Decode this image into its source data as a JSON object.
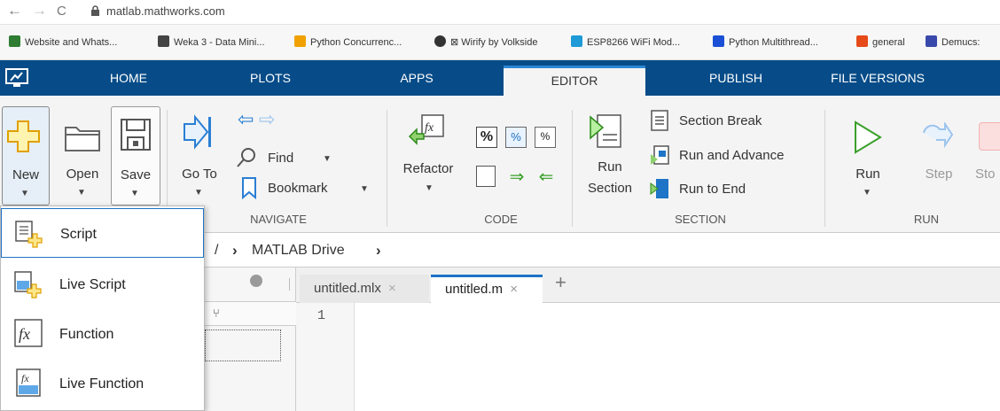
{
  "browser": {
    "nav": {
      "back": "←",
      "forward": "→",
      "reload": "C"
    },
    "url": "matlab.mathworks.com",
    "bookmarks": [
      {
        "label": "Website and Whats...",
        "color": "#2e7d32"
      },
      {
        "label": "Weka 3 - Data Mini...",
        "color": "#444444"
      },
      {
        "label": "Python Concurrenc...",
        "color": "#f0a000"
      },
      {
        "label": "⊠ Wirify by Volkside",
        "color": "#333333"
      },
      {
        "label": "ESP8266 WiFi Mod...",
        "color": "#1e9ad6"
      },
      {
        "label": "Python Multithread...",
        "color": "#1a4fd6"
      },
      {
        "label": "general",
        "color": "#e64a19"
      },
      {
        "label": "Demucs:",
        "color": "#3949ab"
      }
    ]
  },
  "ribbon_tabs": {
    "home": "HOME",
    "plots": "PLOTS",
    "apps": "APPS",
    "editor": "EDITOR",
    "publish": "PUBLISH",
    "file_versions": "FILE VERSIONS"
  },
  "file_group": {
    "new": "New",
    "open": "Open",
    "save": "Save"
  },
  "navigate_group": {
    "go_to": "Go To",
    "find": "Find",
    "bookmark": "Bookmark",
    "label": "NAVIGATE"
  },
  "code_group": {
    "refactor": "Refactor",
    "label": "CODE"
  },
  "section_group": {
    "run_section_1": "Run",
    "run_section_2": "Section",
    "section_break": "Section Break",
    "run_and_advance": "Run and Advance",
    "run_to_end": "Run to End",
    "label": "SECTION"
  },
  "run_group": {
    "run": "Run",
    "step": "Step",
    "stop": "Sto",
    "label": "RUN"
  },
  "path": {
    "sep1": "/",
    "arrow1": "›",
    "folder": "MATLAB Drive",
    "arrow2": "›"
  },
  "editor_tabs": [
    {
      "label": "untitled.mlx",
      "close": "×"
    },
    {
      "label": "untitled.m",
      "close": "×"
    }
  ],
  "add_tab": "+",
  "line_numbers": [
    "1"
  ],
  "new_menu": {
    "items": [
      "Script",
      "Live Script",
      "Function",
      "Live Function"
    ]
  },
  "colors": {
    "ribbon_blue": "#074c88",
    "accent_blue": "#2a86d6",
    "highlight": "#1e74c6"
  }
}
